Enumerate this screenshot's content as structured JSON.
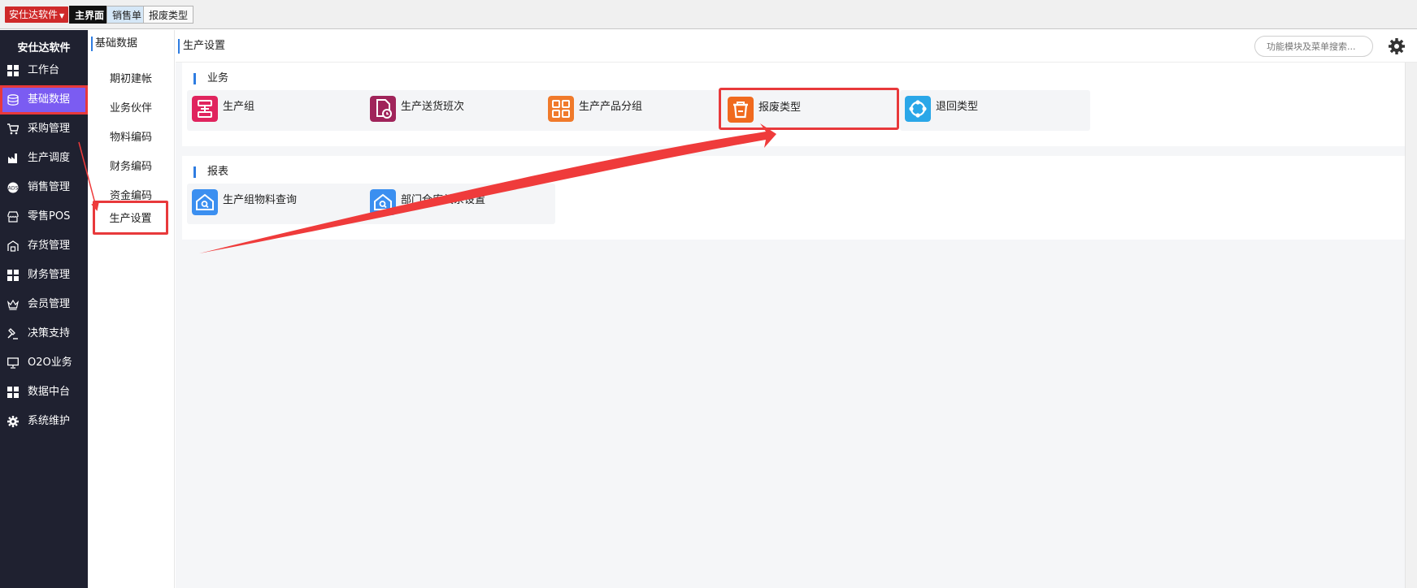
{
  "topbar": {
    "brand": "安仕达软件",
    "tabs": [
      "主界面",
      "销售单",
      "报废类型"
    ]
  },
  "sidebar": {
    "title": "安仕达软件",
    "items": [
      {
        "label": "工作台",
        "icon": "grid-icon"
      },
      {
        "label": "基础数据",
        "icon": "database-icon"
      },
      {
        "label": "采购管理",
        "icon": "cart-icon"
      },
      {
        "label": "生产调度",
        "icon": "factory-icon"
      },
      {
        "label": "销售管理",
        "icon": "badge-icon"
      },
      {
        "label": "零售POS",
        "icon": "store-icon"
      },
      {
        "label": "存货管理",
        "icon": "warehouse-icon"
      },
      {
        "label": "财务管理",
        "icon": "grid-icon"
      },
      {
        "label": "会员管理",
        "icon": "crown-icon"
      },
      {
        "label": "决策支持",
        "icon": "gavel-icon"
      },
      {
        "label": "O2O业务",
        "icon": "monitor-icon"
      },
      {
        "label": "数据中台",
        "icon": "grid-icon"
      },
      {
        "label": "系统维护",
        "icon": "gear-icon"
      }
    ],
    "active_index": 1
  },
  "subnav": {
    "header": "基础数据",
    "items": [
      "期初建帐",
      "业务伙伴",
      "物料编码",
      "财务编码",
      "资金编码",
      "生产设置"
    ],
    "active_index": 5
  },
  "main": {
    "title": "生产设置",
    "search_placeholder": "功能模块及菜单搜索...",
    "sections": [
      {
        "title": "业务",
        "cards": [
          {
            "label": "生产组",
            "icon": "production-group-icon",
            "color": "#e0245e"
          },
          {
            "label": "生产送货班次",
            "icon": "delivery-doc-icon",
            "color": "#a0245a"
          },
          {
            "label": "生产产品分组",
            "icon": "product-group-icon",
            "color": "#f07a2b"
          },
          {
            "label": "报废类型",
            "icon": "trash-icon",
            "color": "#f06a1e"
          },
          {
            "label": "退回类型",
            "icon": "return-circle-icon",
            "color": "#2aa7e8"
          }
        ]
      },
      {
        "title": "报表",
        "cards": [
          {
            "label": "生产组物料查询",
            "icon": "house-search-icon",
            "color": "#3b8ff0"
          },
          {
            "label": "部门仓库关系设置",
            "icon": "house-search-icon",
            "color": "#3b8ff0"
          }
        ]
      }
    ]
  },
  "colors": {
    "sidebar_bg": "#1f2130",
    "sidebar_active": "#7b5cf2",
    "highlight_red": "#e8393b",
    "accent_blue": "#2f7de1"
  }
}
